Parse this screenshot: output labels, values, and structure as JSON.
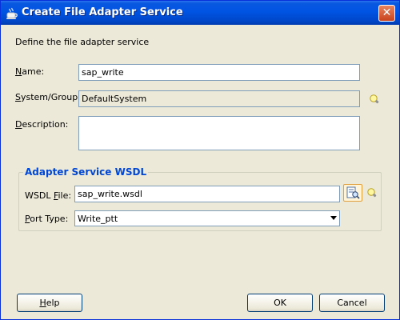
{
  "window": {
    "title": "Create File Adapter Service",
    "close_glyph": "✕"
  },
  "intro": "Define the file adapter service",
  "name": {
    "label_key": "N",
    "label_rest": "ame:",
    "value": "sap_write"
  },
  "system_group": {
    "label_key": "S",
    "label_rest": "ystem/Group:",
    "value": "DefaultSystem"
  },
  "description": {
    "label_key": "D",
    "label_rest": "escription:",
    "value": ""
  },
  "wsdl_group": {
    "title": "Adapter Service WSDL",
    "wsdl_file": {
      "label_pre": "WSDL ",
      "label_key": "F",
      "label_rest": "ile:",
      "value": "sap_write.wsdl"
    },
    "port_type": {
      "label_key": "P",
      "label_rest": "ort Type:",
      "value": "Write_ptt"
    }
  },
  "buttons": {
    "help_key": "H",
    "help_rest": "elp",
    "ok": "OK",
    "cancel": "Cancel"
  },
  "icons": {
    "title": "coffee-cup-icon",
    "hint": "lightbulb-icon",
    "browse": "browse-wsdl-icon",
    "dropdown": "chevron-down-icon"
  },
  "colors": {
    "titlebar": "#0054e3",
    "group_title": "#0046d5",
    "dialog_bg": "#ece9d8"
  }
}
